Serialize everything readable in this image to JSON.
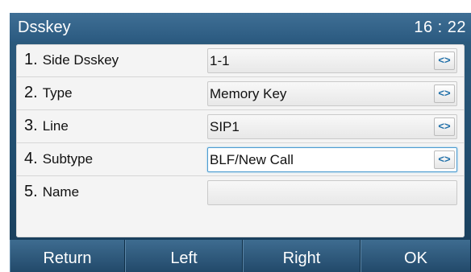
{
  "header": {
    "title": "Dsskey",
    "time": "16 : 22"
  },
  "rows": [
    {
      "number": "1.",
      "label": "Side Dsskey",
      "value": "1-1",
      "has_selector": true,
      "active": false
    },
    {
      "number": "2.",
      "label": "Type",
      "value": "Memory Key",
      "has_selector": true,
      "active": false
    },
    {
      "number": "3.",
      "label": "Line",
      "value": "SIP1",
      "has_selector": true,
      "active": false
    },
    {
      "number": "4.",
      "label": "Subtype",
      "value": "BLF/New Call",
      "has_selector": true,
      "active": true
    },
    {
      "number": "5.",
      "label": "Name",
      "value": "",
      "has_selector": false,
      "active": false
    }
  ],
  "selector_glyph": "<>",
  "softkeys": [
    {
      "label": "Return"
    },
    {
      "label": "Left"
    },
    {
      "label": "Right"
    },
    {
      "label": "OK"
    }
  ],
  "colors": {
    "accent": "#1f6fa8",
    "titlebar": "#2b5a80",
    "active_border": "#4b9bd0"
  }
}
